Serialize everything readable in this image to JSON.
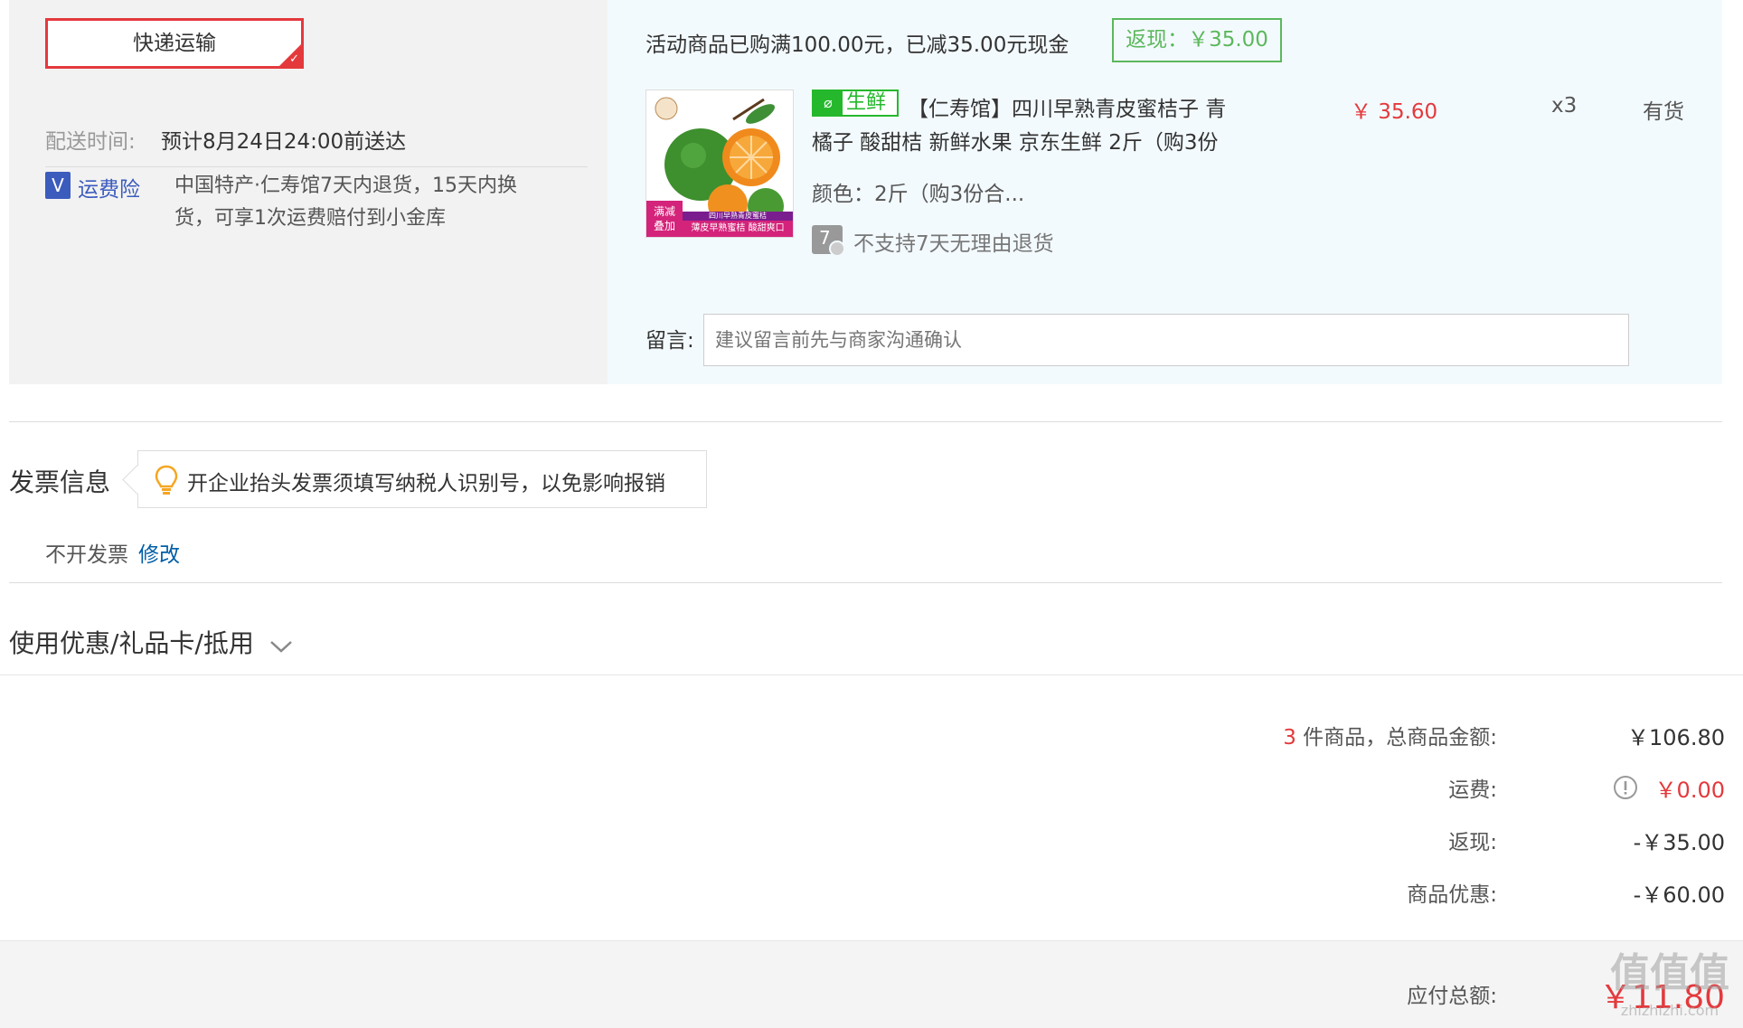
{
  "shipping": {
    "method_label": "快递运输",
    "delivery_time_label": "配送时间:",
    "delivery_time_value": "预计8月24日24:00前送达",
    "insurance_label": "运费险",
    "insurance_desc_line1": "中国特产·仁寿馆7天内退货，15天内换",
    "insurance_desc_line2": "货，可享1次运费赔付到小金库"
  },
  "promo": {
    "text": "活动商品已购满100.00元，已减35.00元现金",
    "cashback_badge": "返现：￥35.00"
  },
  "product": {
    "fresh_tag": "生鲜",
    "title_line1": "【仁寿馆】四川早熟青皮蜜桔子 青",
    "title_line2": "橘子 酸甜桔 新鲜水果 京东生鲜 2斤（购3份",
    "price": "￥ 35.60",
    "quantity": "x3",
    "stock": "有货",
    "color_spec": "颜色：2斤（购3份合...",
    "return_policy_icon_text": "7",
    "return_policy": "不支持7天无理由退货",
    "thumb_badge_line1": "满减",
    "thumb_badge_line2": "叠加",
    "thumb_caption_top": "四川早熟青皮蜜桔",
    "thumb_caption_bottom": "薄皮早熟蜜桔 酸甜爽口"
  },
  "note": {
    "label": "留言:",
    "placeholder": "建议留言前先与商家沟通确认"
  },
  "invoice": {
    "title": "发票信息",
    "tip": "开企业抬头发票须填写纳税人识别号，以免影响报销",
    "status": "不开发票",
    "edit_link": "修改"
  },
  "coupon": {
    "title": "使用优惠/礼品卡/抵用"
  },
  "summary": {
    "item_count": "3",
    "total_label": "件商品，总商品金额:",
    "total_value": "￥106.80",
    "freight_label": "运费:",
    "freight_value": "￥0.00",
    "cashback_label": "返现:",
    "cashback_value": "-￥35.00",
    "discount_label": "商品优惠:",
    "discount_value": "-￥60.00",
    "payable_label": "应付总额:",
    "payable_value": "￥11.80"
  },
  "watermark": {
    "text": "值值值",
    "url": "zhizhizhi.com"
  },
  "colors": {
    "accent_red": "#e4393c",
    "fresh_green": "#25b82c",
    "cashback_green": "#5cb85c",
    "freight_orange": "#e4393c",
    "link_blue": "#005ea7"
  }
}
